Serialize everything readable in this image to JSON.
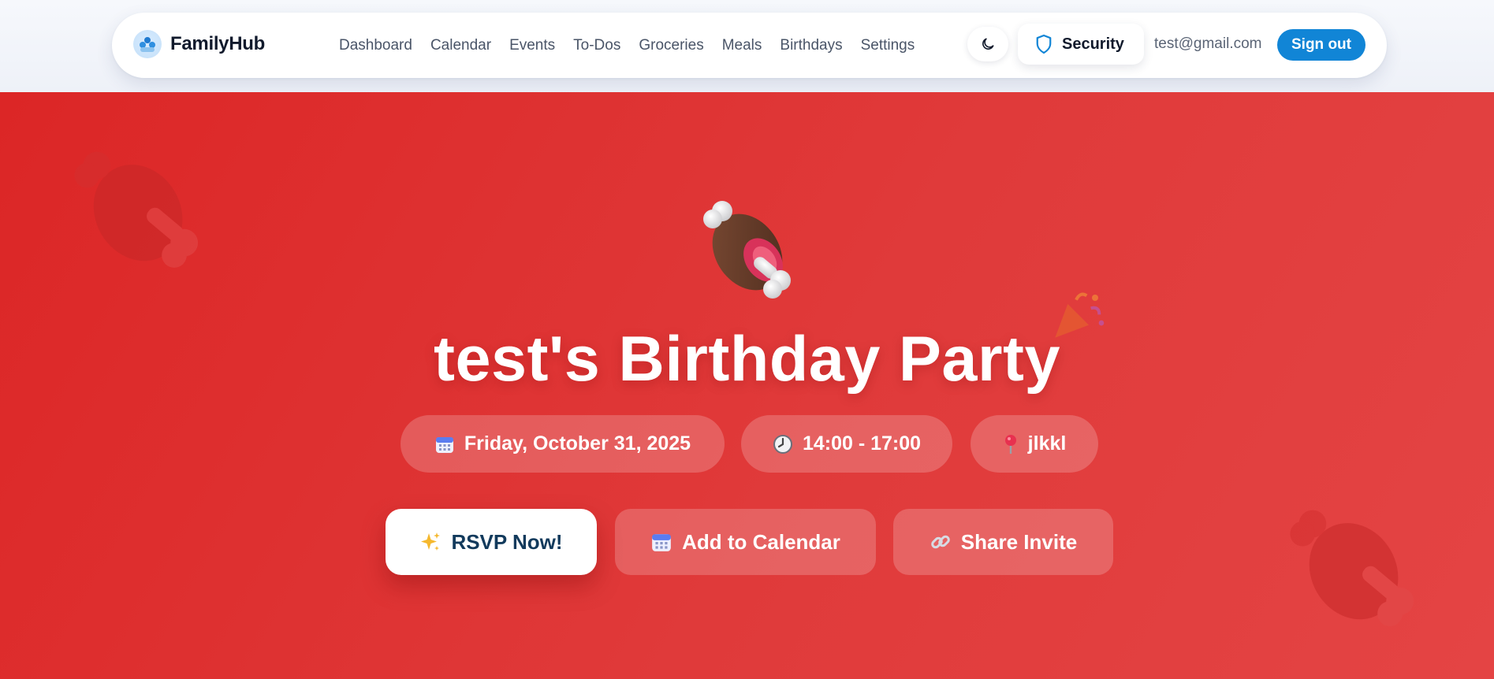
{
  "app": {
    "name": "FamilyHub"
  },
  "nav": {
    "links": [
      "Dashboard",
      "Calendar",
      "Events",
      "To-Dos",
      "Groceries",
      "Meals",
      "Birthdays",
      "Settings"
    ]
  },
  "header": {
    "security_label": "Security",
    "user_email": "test@gmail.com",
    "signout_label": "Sign out"
  },
  "event": {
    "title": "test's Birthday Party",
    "date": "Friday, October 31, 2025",
    "time": "14:00 - 17:00",
    "location": "jlkkl"
  },
  "actions": {
    "rsvp": "RSVP Now!",
    "add_calendar": "Add to Calendar",
    "share": "Share Invite"
  },
  "icons": {
    "hero": "meat-on-bone-icon",
    "date": "calendar-icon",
    "time": "clock-icon",
    "location": "pin-icon",
    "rsvp": "sparkles-icon",
    "add_calendar": "calendar-icon",
    "share": "link-icon"
  },
  "colors": {
    "hero_bg": "#dc2626",
    "accent": "#1185d6",
    "rsvp_text": "#123a5c"
  }
}
